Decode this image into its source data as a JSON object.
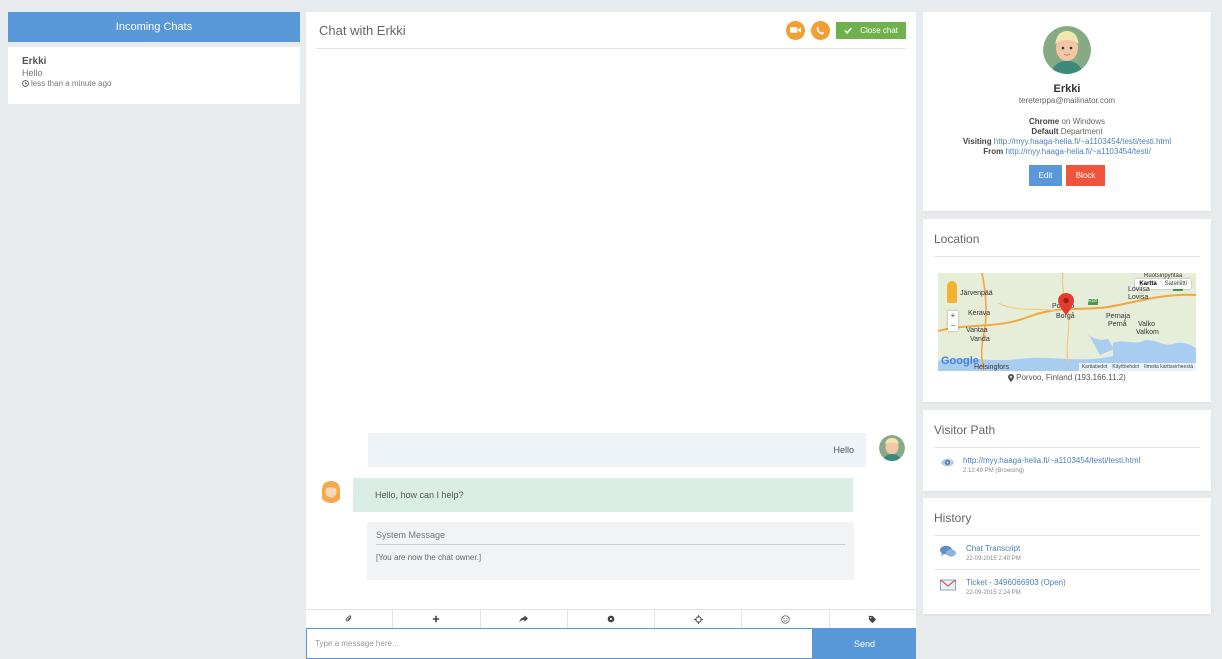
{
  "incoming": {
    "header": "Incoming Chats",
    "items": [
      {
        "name": "Erkki",
        "preview": "Hello",
        "time": "less than a minute ago"
      }
    ]
  },
  "chat": {
    "title": "Chat with Erkki",
    "close_label": "Close chat",
    "messages": {
      "outgoing": "Hello",
      "incoming": "Hello, how can I help?",
      "system_title": "System Message",
      "system_text": "[You are now the chat owner.]"
    },
    "toolbar_icons": [
      "paperclip-icon",
      "plus-icon",
      "forward-icon",
      "circle-icon",
      "crosshair-icon",
      "smiley-icon",
      "tag-icon"
    ],
    "input_placeholder": "Type a message here...",
    "send_label": "Send"
  },
  "visitor": {
    "name": "Erkki",
    "email": "tereterppa@mailinator.com",
    "browser": "Chrome",
    "browser_suffix": " on Windows",
    "department": "Default",
    "department_suffix": " Department",
    "visiting_label": "Visiting ",
    "visiting_url": "http://myy.haaga-helia.fi/~a1103454/testi/testi.html",
    "from_label": "From ",
    "from_url": "http://myy.haaga-helia.fi/~a1103454/testi/",
    "edit_label": "Edit",
    "block_label": "Block"
  },
  "location": {
    "title": "Location",
    "caption": "Porvoo, Finland (193.166.11.2)",
    "map": {
      "toggle_map": "Kartta",
      "toggle_sat": "Satelliitti",
      "footer": [
        "Karttatiedot",
        "Käyttöehdot",
        "Ilmoita karttavirheestä"
      ],
      "logo": "Google",
      "places": [
        "Järvenpää",
        "Kerava",
        "Vantaa",
        "Vanda",
        "Porvoo",
        "Borgå",
        "Loviisa",
        "Lovisa",
        "Pernaja",
        "Pernå",
        "Valko",
        "Valkom",
        "Helsingfors",
        "Ruotsinpyhtää",
        "E18"
      ]
    }
  },
  "visitor_path": {
    "title": "Visitor Path",
    "items": [
      {
        "url": "http://myy.haaga-helia.fi/~a1103454/testi/testi.html",
        "meta": "2:12:49 PM (Browsing)"
      }
    ]
  },
  "history": {
    "title": "History",
    "items": [
      {
        "label": "Chat Transcript",
        "date": "22-09-2015 2:40 PM"
      },
      {
        "label": "Ticket - 3496066903 (Open)",
        "date": "22-09-2015 2:24 PM"
      }
    ]
  },
  "colors": {
    "accent": "#5897d8",
    "success": "#6fb14b",
    "danger": "#f0553c",
    "warning": "#f0a030",
    "background": "#e8ebee"
  }
}
